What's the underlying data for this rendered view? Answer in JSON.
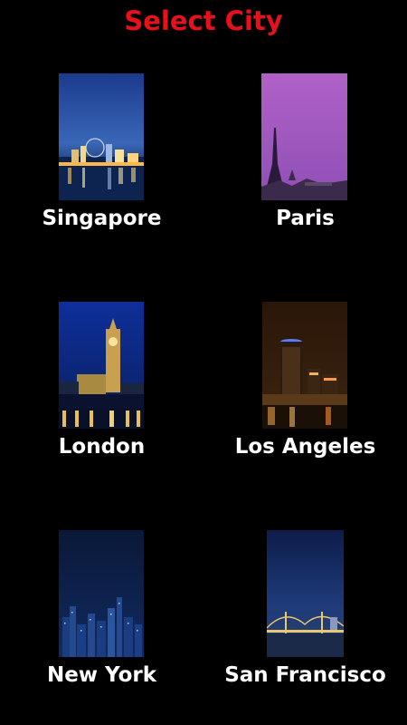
{
  "header": {
    "title": "Select City",
    "title_color": "#e8101a"
  },
  "cities": [
    {
      "label": "Singapore",
      "image": "singapore-skyline-night-image"
    },
    {
      "label": "Paris",
      "image": "eiffel-tower-dusk-image"
    },
    {
      "label": "London",
      "image": "big-ben-night-image"
    },
    {
      "label": "Los Angeles",
      "image": "los-angeles-night-image"
    },
    {
      "label": "New York",
      "image": "new-york-skyline-night-image"
    },
    {
      "label": "San Francisco",
      "image": "bay-bridge-night-image"
    }
  ]
}
